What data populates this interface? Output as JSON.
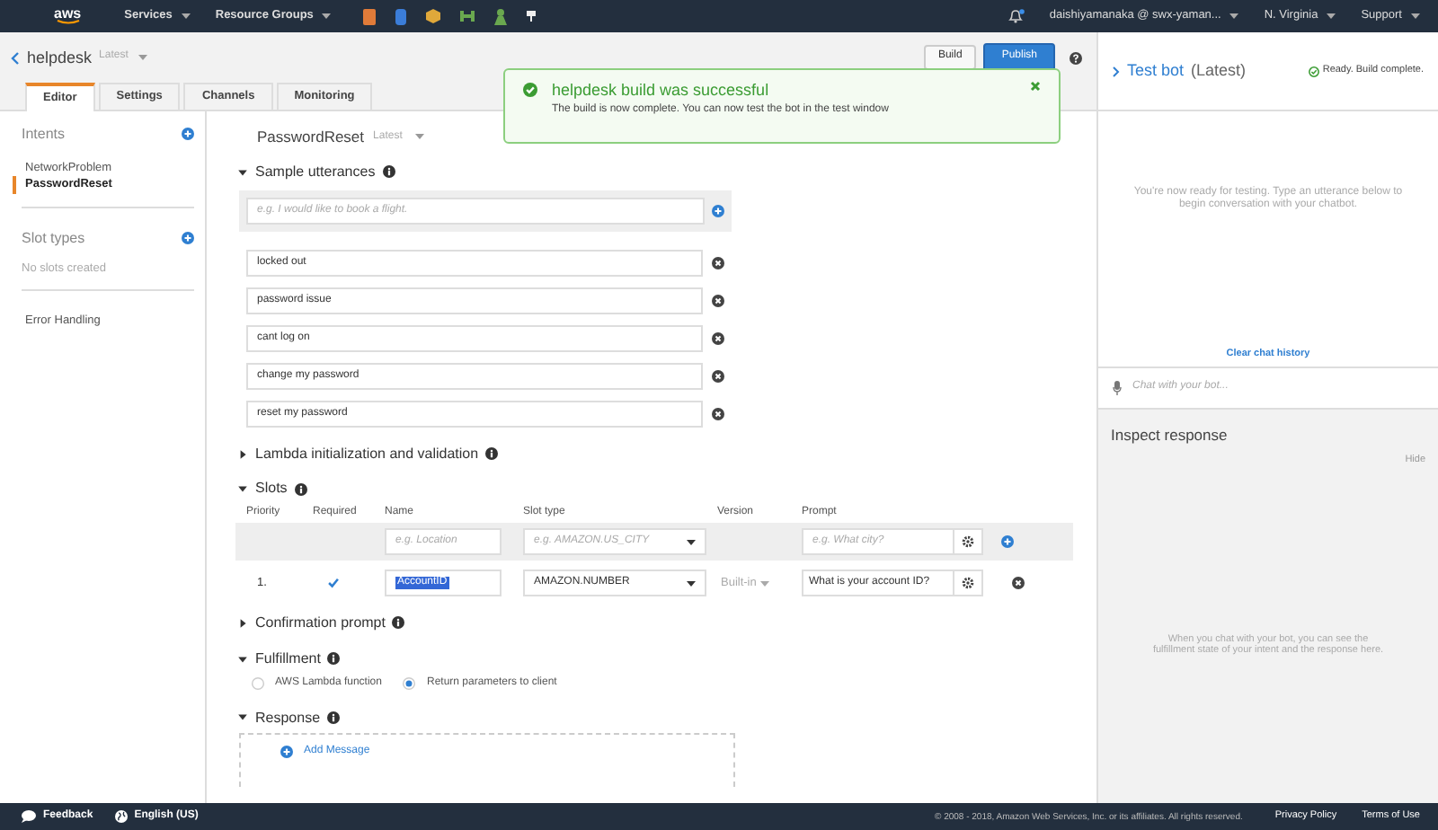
{
  "top_nav": {
    "logo": "aws",
    "menus": [
      "Services",
      "Resource Groups"
    ],
    "account": "daishiyamanaka @ swx-yaman...",
    "region": "N. Virginia",
    "support": "Support"
  },
  "bot": {
    "name": "helpdesk",
    "version": "Latest"
  },
  "tabs": [
    {
      "label": "Editor",
      "selected": true
    },
    {
      "label": "Settings",
      "selected": false
    },
    {
      "label": "Channels",
      "selected": false
    },
    {
      "label": "Monitoring",
      "selected": false
    }
  ],
  "buttons": [
    {
      "label": "Build",
      "kind": "default"
    },
    {
      "label": "Publish",
      "kind": "primary"
    }
  ],
  "notification": {
    "title": "helpdesk build was successful",
    "message": "The build is now complete. You can now test the bot in the test window"
  },
  "sidebar": {
    "intents": {
      "title": "Intents",
      "items": [
        {
          "label": "NetworkProblem",
          "selected": false
        },
        {
          "label": "PasswordReset",
          "selected": true
        }
      ]
    },
    "slot_types": {
      "title": "Slot types",
      "empty": "No slots created"
    },
    "error_handling": "Error Handling"
  },
  "intent": {
    "name": "PasswordReset",
    "version": "Latest",
    "sections": [
      {
        "kind": "utterances",
        "title": "Sample utterances",
        "expanded": true,
        "placeholder": "e.g. I would like to book a flight.",
        "items": [
          "locked out",
          "password issue",
          "cant log on",
          "change my password",
          "reset my password"
        ]
      },
      {
        "kind": "plain",
        "title": "Lambda initialization and validation",
        "expanded": false
      },
      {
        "kind": "slots",
        "title": "Slots",
        "expanded": true,
        "columns": [
          "Priority",
          "Required",
          "Name",
          "Slot type",
          "Version",
          "Prompt"
        ],
        "new_row": {
          "name_placeholder": "e.g. Location",
          "type_placeholder": "e.g. AMAZON.US_CITY",
          "prompt_placeholder": "e.g. What city?"
        },
        "rows": [
          {
            "priority": "1.",
            "required": true,
            "name": "AccountID",
            "name_selected": true,
            "slot_type": "AMAZON.NUMBER",
            "version": "Built-in",
            "prompt": "What is your account ID?"
          }
        ]
      },
      {
        "kind": "plain",
        "title": "Confirmation prompt",
        "expanded": false
      },
      {
        "kind": "fulfillment",
        "title": "Fulfillment",
        "expanded": true,
        "options": [
          {
            "label": "AWS Lambda function",
            "selected": false
          },
          {
            "label": "Return parameters to client",
            "selected": true
          }
        ]
      },
      {
        "kind": "response",
        "title": "Response",
        "expanded": true,
        "add_message": "Add Message"
      }
    ]
  },
  "test_bot": {
    "title": "Test bot",
    "version": "(Latest)",
    "status": "Ready. Build complete.",
    "intro": "You're now ready for testing. Type an utterance below to begin conversation with your chatbot.",
    "clear": "Clear chat history",
    "chat_placeholder": "Chat with your bot...",
    "inspect": {
      "title": "Inspect response",
      "hide": "Hide",
      "message": "When you chat with your bot, you can see the fulfillment state of your intent and the response here."
    }
  },
  "footer": {
    "feedback": "Feedback",
    "language": "English (US)",
    "copyright": "© 2008 - 2018, Amazon Web Services, Inc. or its affiliates. All rights reserved.",
    "links": [
      "Privacy Policy",
      "Terms of Use"
    ]
  }
}
